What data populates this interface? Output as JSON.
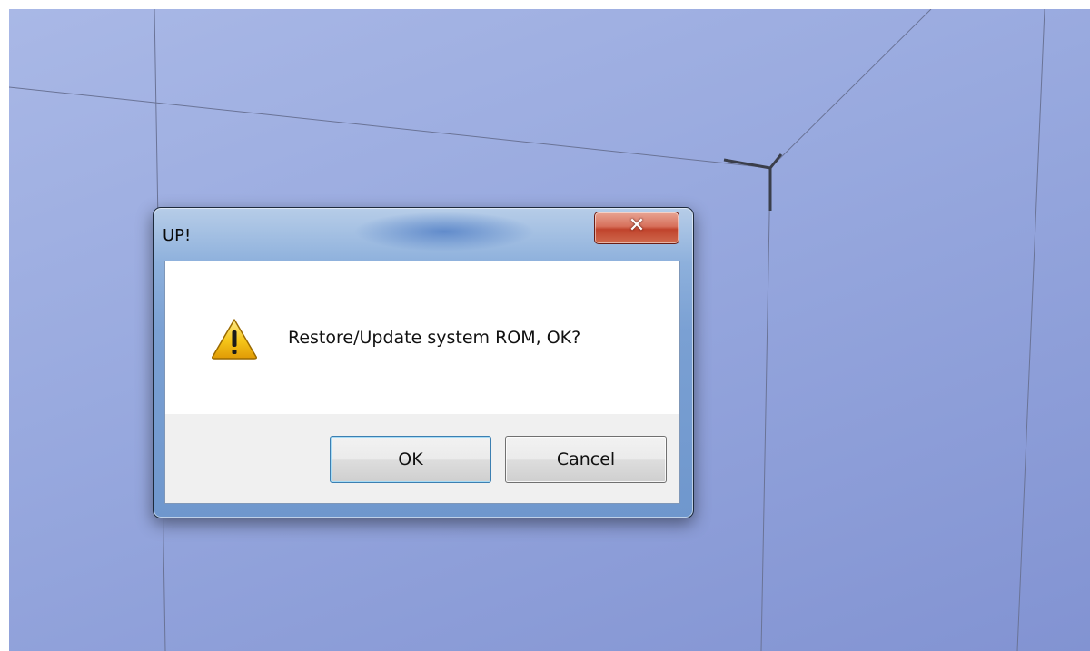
{
  "dialog": {
    "title": "UP!",
    "close_icon": "close-icon",
    "message_icon": "warning-icon",
    "message": "Restore/Update system ROM, OK?",
    "ok_label": "OK",
    "cancel_label": "Cancel",
    "close_glyph": "✕"
  },
  "colors": {
    "viewport_background": "#97a8de",
    "dialog_frame": "#7aa0d3",
    "close_button": "#c0432c",
    "warning_yellow": "#f5c518",
    "button_face": "#e5e5e5"
  }
}
